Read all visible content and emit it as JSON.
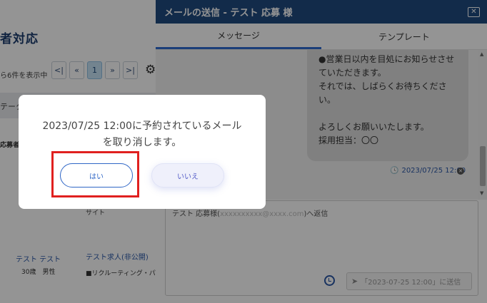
{
  "background": {
    "page_title": "者対応",
    "result_count": "ら6件を表示中",
    "pagination": [
      "<|",
      "«",
      "1",
      "»",
      ">|"
    ],
    "header_cell": "テータ",
    "applicant_label": "応募者",
    "site_label": "サイト",
    "candidate_name": "テスト テスト",
    "candidate_age": "30歳　男性",
    "job_title": "テスト求人(非公開)",
    "company": "■リクルーティング・パ"
  },
  "panel": {
    "title": "メールの送信 - テスト 応募 様",
    "close_label": "✕",
    "tabs": [
      "メッセージ",
      "テンプレート"
    ],
    "message_text": "●営業日以内を目処にお知らせさせていただきます。\nそれでは、しばらくお待ちください。\n\nよろしくお願いいたします。\n採用担当：〇〇",
    "message_time": "2023/07/25 12:00",
    "reply_to_prefix": "テスト 応募様(",
    "reply_to_email": "xxxxxxxxxx@xxxx.com",
    "reply_to_suffix": ")へ返信",
    "scheduled_send_label": "「2023-07-25 12:00」に送信"
  },
  "dialog": {
    "message_line1": "2023/07/25 12:00に予約されているメール",
    "message_line2": "を取り消します。",
    "yes_label": "はい",
    "no_label": "いいえ"
  },
  "colors": {
    "panel_header": "#1f4a80",
    "accent": "#2f66c6",
    "highlight": "#e0201f"
  }
}
